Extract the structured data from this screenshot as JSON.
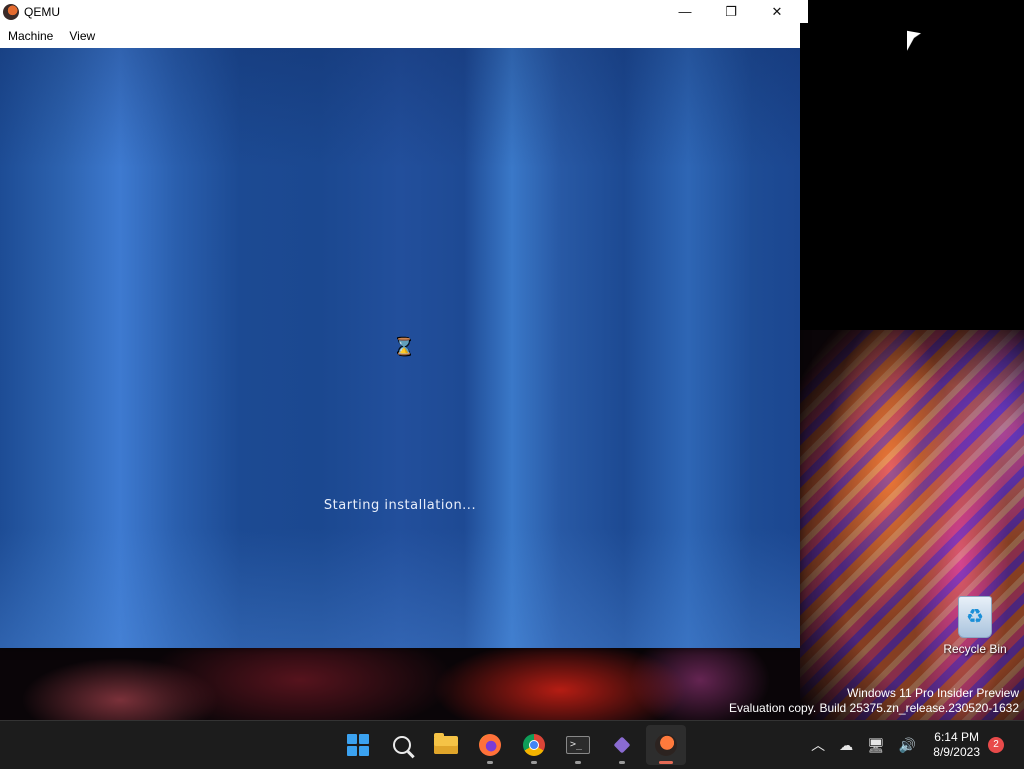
{
  "window": {
    "title": "QEMU",
    "menu": [
      "Machine",
      "View"
    ],
    "controls": {
      "minimize": "—",
      "restore": "❐",
      "close": "✕"
    }
  },
  "vm": {
    "status_text": "Starting installation...",
    "hourglass": "⌛"
  },
  "desktop": {
    "recycle_bin_label": "Recycle Bin",
    "recycle_glyph": "♻",
    "watermark_line1": "Windows 11 Pro Insider Preview",
    "watermark_line2": "Evaluation copy. Build 25375.zn_release.230520-1632"
  },
  "taskbar": {
    "terminal_glyph": ">_",
    "tray": {
      "chevron": "︿",
      "cloud": "☁",
      "network": "🖥",
      "volume": "🔊",
      "time": "6:14 PM",
      "date": "8/9/2023",
      "notification_count": "2"
    }
  },
  "colors": {
    "taskbar_bg": "#1c1c1c",
    "vm_blue": "#1e4a94",
    "active_indicator": "#e46a55",
    "badge_red": "#e84a4a"
  }
}
